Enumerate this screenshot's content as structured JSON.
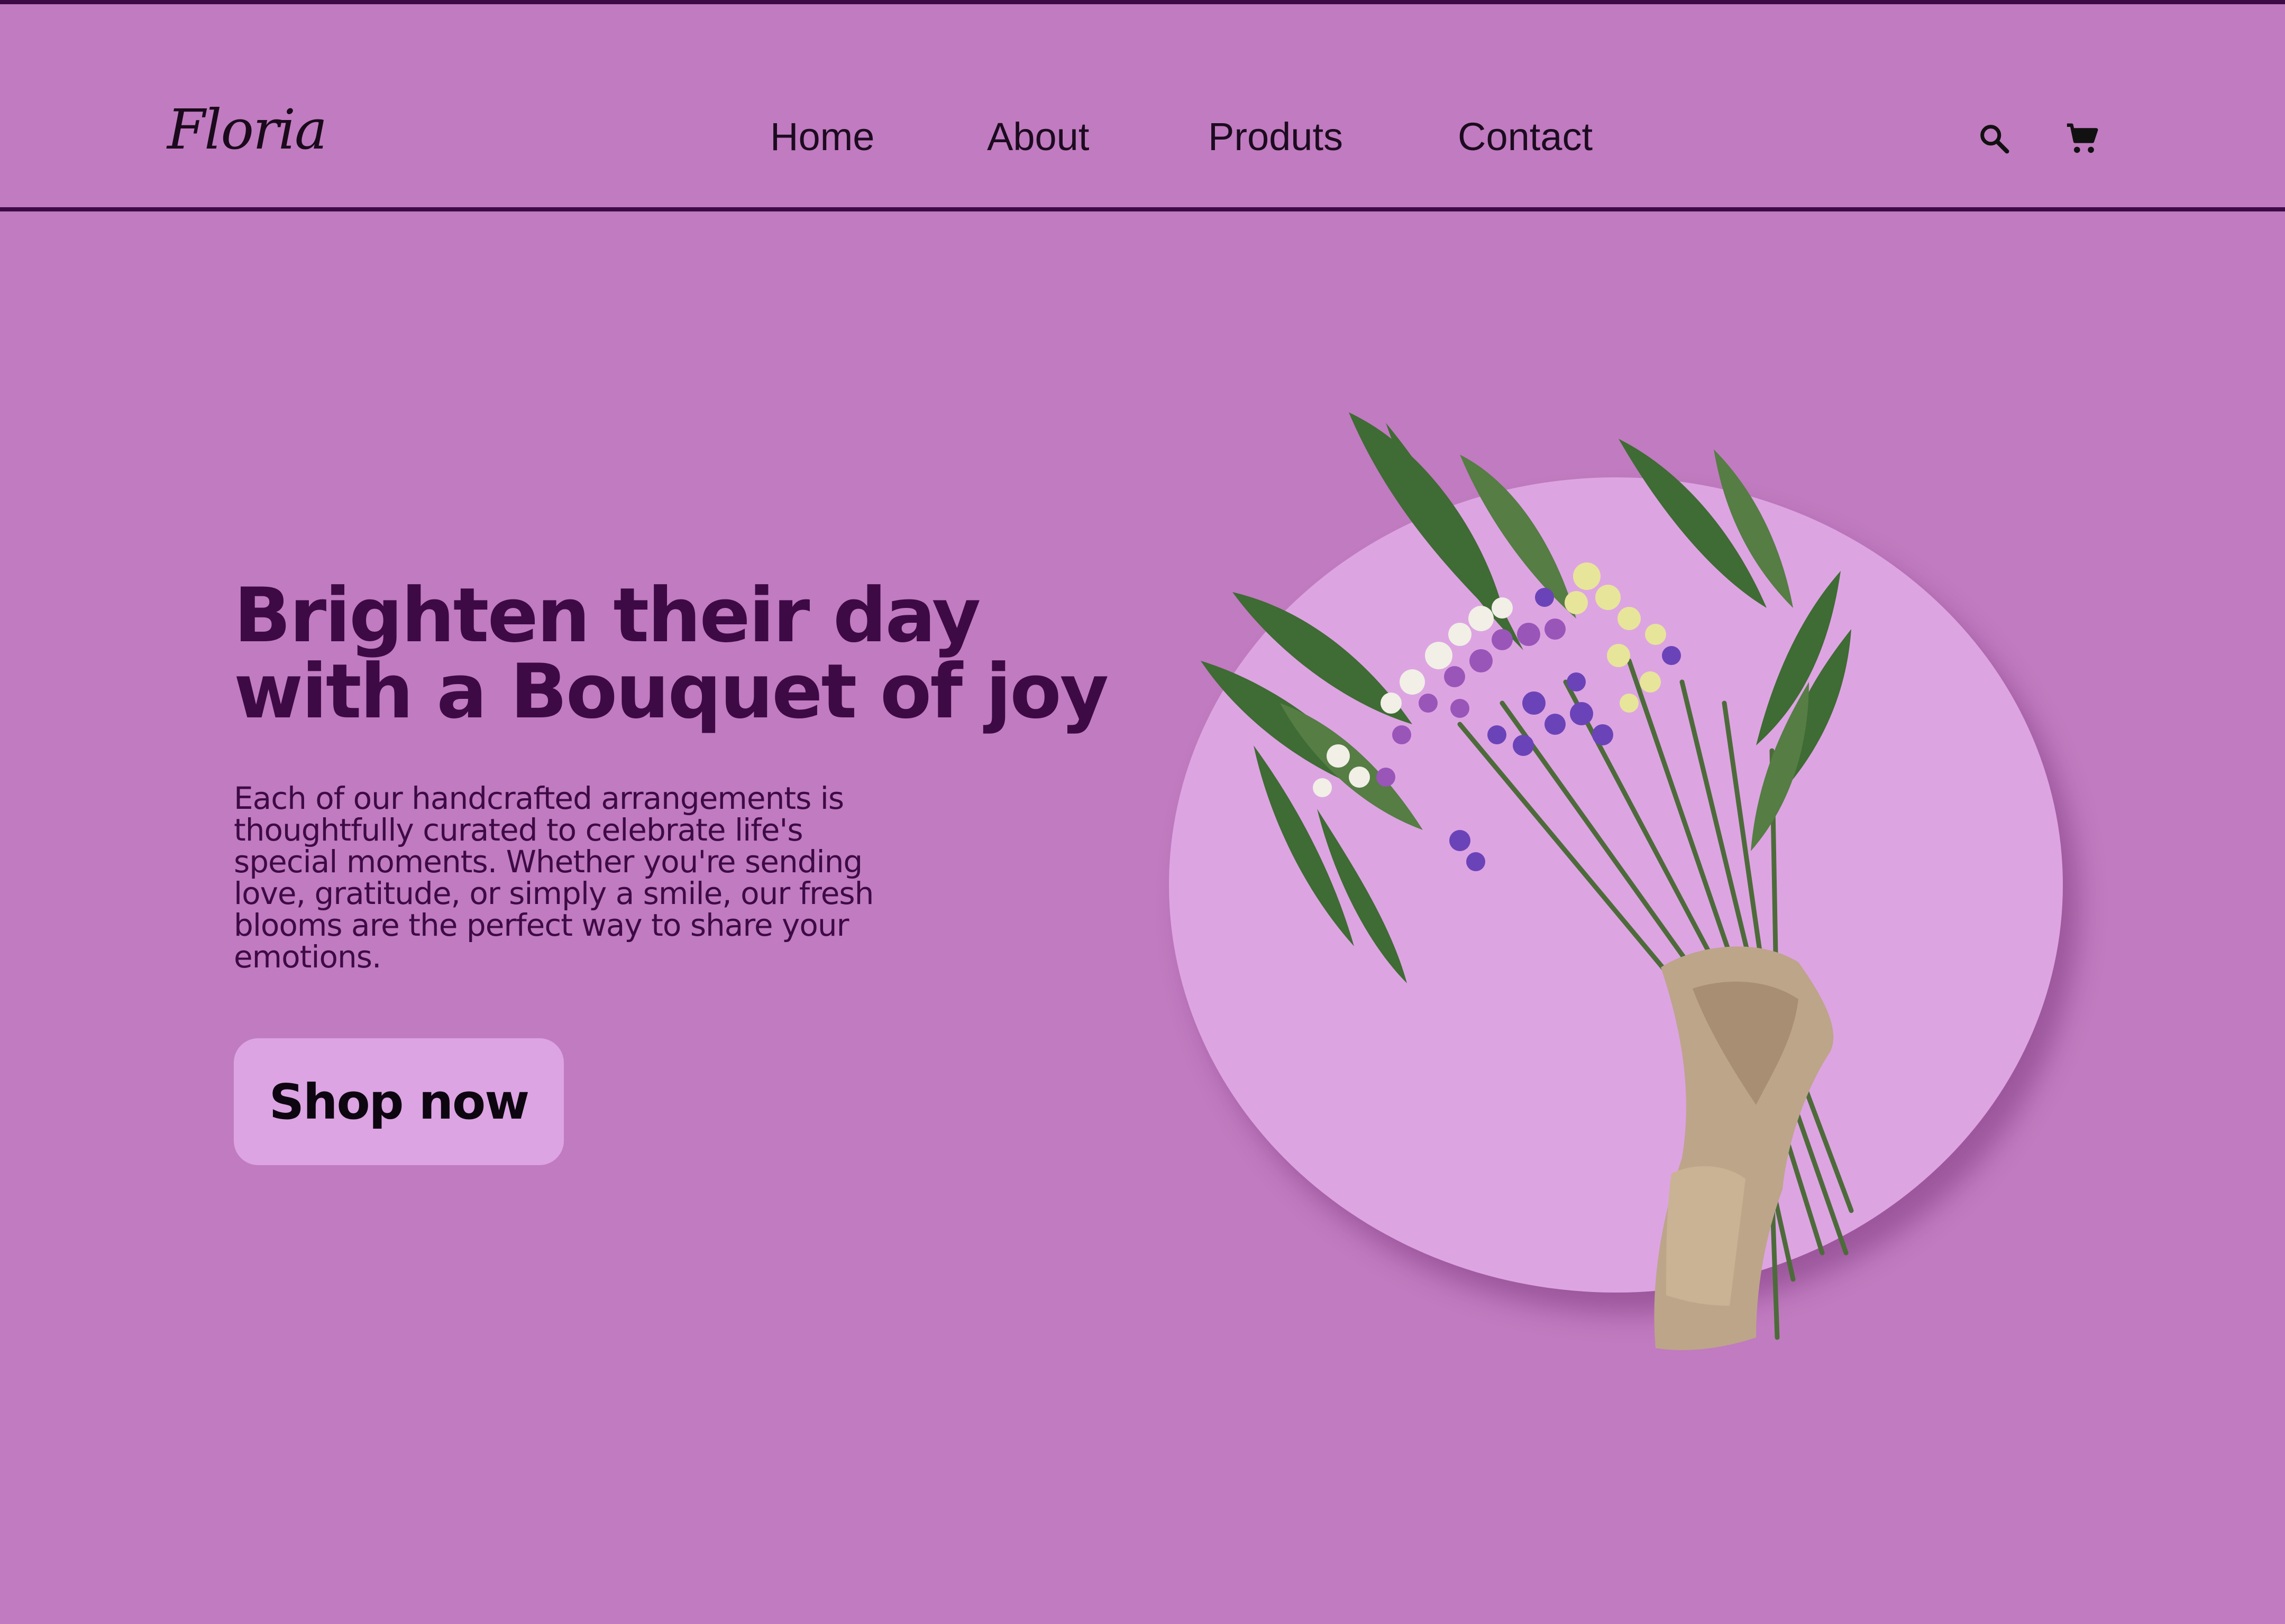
{
  "brand": {
    "logo_text": "Floria"
  },
  "nav": {
    "links": [
      {
        "label": "Home"
      },
      {
        "label": "About"
      },
      {
        "label": "Produts"
      },
      {
        "label": "Contact"
      }
    ],
    "icons": [
      "search-icon",
      "cart-icon"
    ]
  },
  "hero": {
    "headline_line1": "Brighten their day",
    "headline_line2": "with a Bouquet of joy",
    "description": "Each of our handcrafted arrangements is thoughtfully curated to celebrate life's special moments. Whether you're sending love, gratitude, or simply a smile, our fresh blooms are the perfect way to share your emotions.",
    "cta_label": "Shop now",
    "image": "bouquet-image"
  },
  "colors": {
    "background": "#c17bc0",
    "accent_dark": "#3d0a45",
    "button_bg": "#dca4e2",
    "circle": "#dda4e2"
  }
}
